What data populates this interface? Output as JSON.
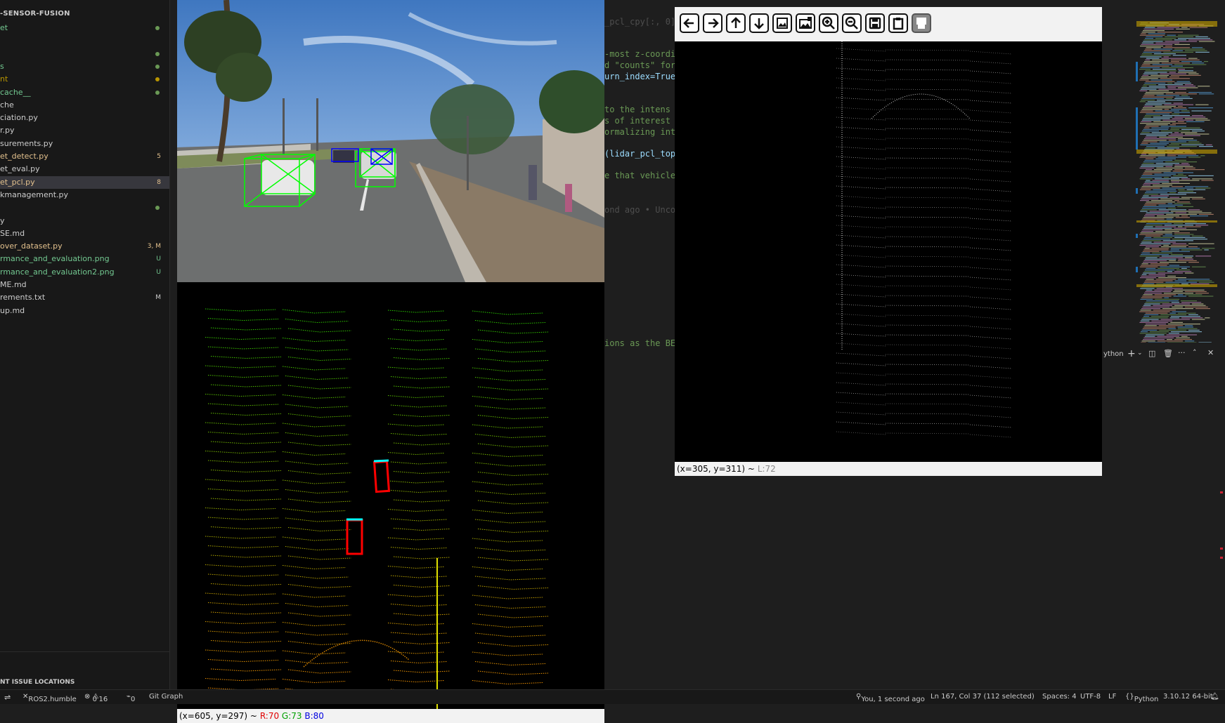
{
  "explorer": {
    "project_title": "-SENSOR-FUSION",
    "files": [
      {
        "label": "et",
        "color": "green",
        "badge": "",
        "dot": true
      },
      {
        "label": "",
        "color": "white",
        "badge": "",
        "dot": false
      },
      {
        "label": "",
        "color": "white",
        "badge": "",
        "dot": true
      },
      {
        "label": "s",
        "color": "green",
        "badge": "",
        "dot": true
      },
      {
        "label": "nt",
        "color": "olive",
        "badge": "",
        "dot": true
      },
      {
        "label": "cache__",
        "color": "green",
        "badge": "",
        "dot": true
      },
      {
        "label": "che",
        "color": "white",
        "badge": "",
        "dot": false
      },
      {
        "label": "ciation.py",
        "color": "white",
        "badge": "",
        "dot": false
      },
      {
        "label": "r.py",
        "color": "white",
        "badge": "",
        "dot": false
      },
      {
        "label": "surements.py",
        "color": "white",
        "badge": "",
        "dot": false
      },
      {
        "label": "et_detect.py",
        "color": "yellow",
        "badge": "5",
        "dot": false
      },
      {
        "label": "et_eval.py",
        "color": "white",
        "badge": "",
        "dot": false
      },
      {
        "label": "et_pcl.py",
        "color": "yellow",
        "badge": "8",
        "dot": false
      },
      {
        "label": "kmanagement.py",
        "color": "white",
        "badge": "",
        "dot": false
      },
      {
        "label": "",
        "color": "white",
        "badge": "",
        "dot": true
      },
      {
        "label": "y",
        "color": "white",
        "badge": "",
        "dot": false
      },
      {
        "label": "SE.md",
        "color": "white",
        "badge": "",
        "dot": false
      },
      {
        "label": "over_dataset.py",
        "color": "yellow",
        "badge": "3, M",
        "dot": false
      },
      {
        "label": "rmance_and_evaluation.png",
        "color": "green",
        "badge": "U",
        "dot": false
      },
      {
        "label": "rmance_and_evaluation2.png",
        "color": "green",
        "badge": "U",
        "dot": false
      },
      {
        "label": "ME.md",
        "color": "white",
        "badge": "",
        "dot": false
      },
      {
        "label": "rements.txt",
        "color": "white",
        "badge": "M",
        "dot": false
      },
      {
        "label": "up.md",
        "color": "white",
        "badge": "",
        "dot": false
      }
    ],
    "problems_title": "NT ISSUE LOCATIONS"
  },
  "editor": {
    "lines": [
      {
        "text": "_pcl_cpy[:, 0],",
        "cls": "dim"
      },
      {
        "text": "-most z-coordi",
        "cls": "cmt"
      },
      {
        "text": "d \"counts\" for",
        "cls": "cmt"
      },
      {
        "text": "urn_index=True",
        "cls": "code"
      },
      {
        "text": " to the intens",
        "cls": "cmt"
      },
      {
        "text": "s of interest",
        "cls": "cmt"
      },
      {
        "text": "ormalizing int",
        "cls": "cmt"
      },
      {
        "text": "(lidar_pcl_top",
        "cls": "code"
      },
      {
        "text": "e that vehicle",
        "cls": "cmt"
      },
      {
        "text": "ond ago • Unco",
        "cls": "dim"
      },
      {
        "text": "ions as the BE",
        "cls": "cmt"
      }
    ],
    "panel_label": "ython"
  },
  "camera_viewer": {
    "status_coords": "(x=605, y=297) ~",
    "r": "R:70",
    "g": "G:73",
    "b": "B:80"
  },
  "bev_viewer": {
    "status_coords": "(x=305, y=311) ~",
    "l": "L:72",
    "toolbar": [
      "arrow-left-icon",
      "arrow-right-icon",
      "arrow-up-icon",
      "arrow-down-icon",
      "image-icon",
      "image-fit-icon",
      "zoom-in-icon",
      "zoom-out-icon",
      "save-icon",
      "clipboard-icon",
      "properties-icon"
    ]
  },
  "statusbar": {
    "remote": "ROS2.humble",
    "errors": "0",
    "warnings": "16",
    "ports": "0",
    "git_graph": "Git Graph",
    "blame": "You, 1 second ago",
    "cursor": "Ln 167, Col 37 (112 selected)",
    "spaces": "Spaces: 4",
    "encoding": "UTF-8",
    "eol": "LF",
    "language": "Python",
    "interpreter": "3.10.12 64-bit"
  },
  "colors": {
    "accent_blue": "#007acc",
    "git_yellow": "#e2c08d",
    "git_green": "#73c991",
    "box_green": "#00ff00",
    "box_red": "#ff0000",
    "box_cyan": "#00ffff"
  }
}
